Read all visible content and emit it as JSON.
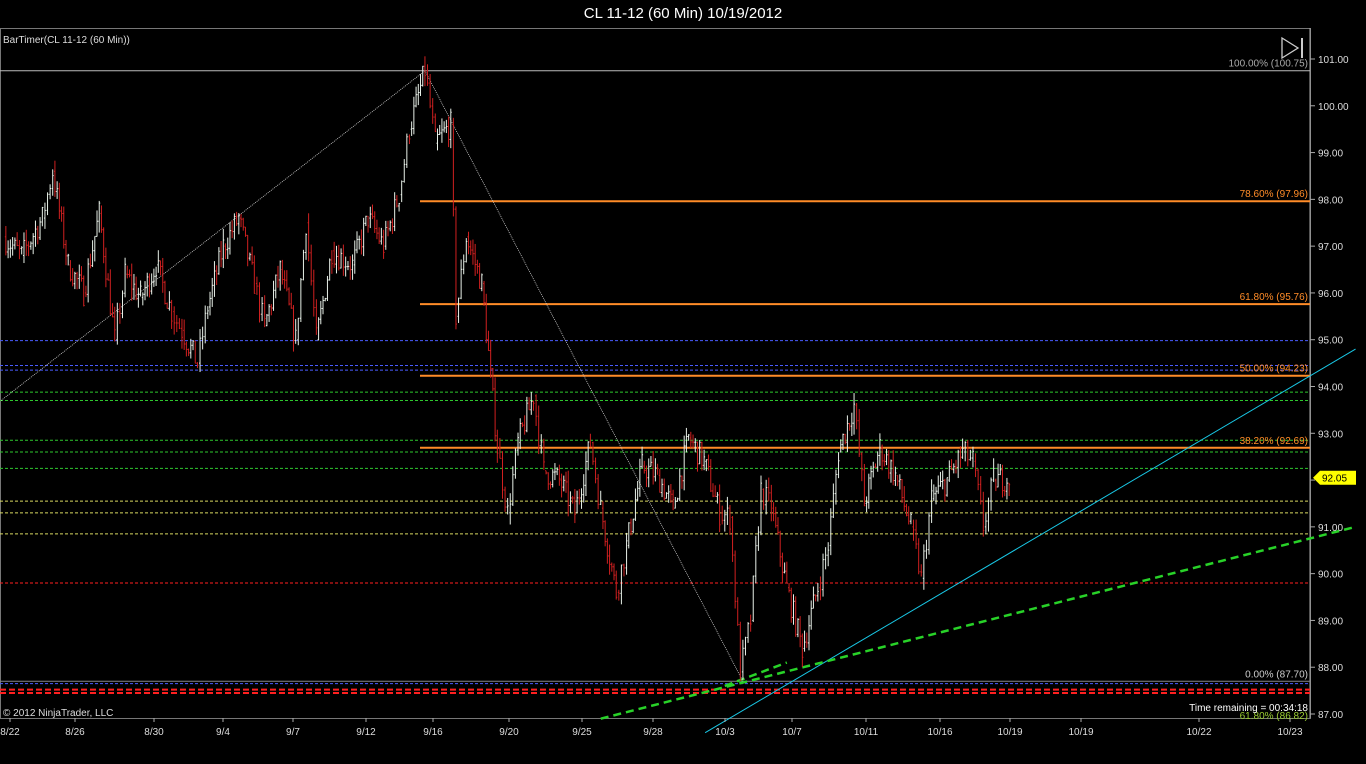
{
  "window": {
    "title": "CL 11-12 (60 Min)  10/19/2012"
  },
  "indicator_label": "BarTimer(CL 11-12 (60 Min))",
  "copyright": "© 2012 NinjaTrader, LLC",
  "time_remaining": "Time remaining = 00:34:18",
  "play_icon": "skip-forward-icon",
  "colors": {
    "background": "#000000",
    "grid": "#555555",
    "up_bar": "#e8f0e8",
    "down_bar": "#d02020",
    "fib": "#ff8c28",
    "price_tag": "#ffff00",
    "trend_cyan": "#19c8e6",
    "trend_green": "#28d228",
    "blue_level": "#4a5cff",
    "green_level": "#2ec82e",
    "yellow_level": "#d8d860",
    "red_level": "#ff2020"
  },
  "chart_data": {
    "type": "candlestick",
    "symbol": "CL 11-12",
    "interval": "60 Min",
    "ylim": [
      87.0,
      101.0
    ],
    "y_ticks": [
      "101.00",
      "100.00",
      "99.00",
      "98.00",
      "97.00",
      "96.00",
      "95.00",
      "94.00",
      "93.00",
      "92.00",
      "91.00",
      "90.00",
      "89.00",
      "88.00",
      "87.00"
    ],
    "x_ticks": [
      "8/22",
      "8/26",
      "8/30",
      "9/4",
      "9/7",
      "9/12",
      "9/16",
      "9/20",
      "9/25",
      "9/28",
      "10/3",
      "10/7",
      "10/11",
      "10/16",
      "10/19",
      "10/19",
      "10/22",
      "10/23"
    ],
    "last_price": "92.05",
    "fib_levels": [
      {
        "label": "100.00% (100.75)",
        "value": 100.75
      },
      {
        "label": "78.60% (97.96)",
        "value": 97.96
      },
      {
        "label": "61.80% (95.76)",
        "value": 95.76
      },
      {
        "label": "50.00% (94.23)",
        "value": 94.23
      },
      {
        "label": "38.20% (92.69)",
        "value": 92.69
      },
      {
        "label": "0.00% (87.70)",
        "value": 87.7
      },
      {
        "label": "61.80% (86.82)",
        "value": 86.82
      }
    ],
    "horizontal_levels": [
      {
        "kind": "blue",
        "value": 94.98
      },
      {
        "kind": "blue",
        "value": 94.45
      },
      {
        "kind": "blue",
        "value": 94.35
      },
      {
        "kind": "green",
        "value": 93.88
      },
      {
        "kind": "green",
        "value": 93.7
      },
      {
        "kind": "green",
        "value": 92.85
      },
      {
        "kind": "green",
        "value": 92.6
      },
      {
        "kind": "green",
        "value": 92.25
      },
      {
        "kind": "yellow",
        "value": 91.55
      },
      {
        "kind": "yellow",
        "value": 91.3
      },
      {
        "kind": "yellow",
        "value": 90.85
      },
      {
        "kind": "red",
        "value": 89.8
      },
      {
        "kind": "blue",
        "value": 87.65
      },
      {
        "kind": "red",
        "value": 87.52
      },
      {
        "kind": "red",
        "value": 87.45
      }
    ],
    "price_path": [
      [
        0.5,
        97.2
      ],
      [
        4,
        96.8
      ],
      [
        8,
        97.6
      ],
      [
        10,
        98.6
      ],
      [
        13,
        96.6
      ],
      [
        16,
        96.0
      ],
      [
        19,
        97.7
      ],
      [
        22,
        95.0
      ],
      [
        24,
        96.4
      ],
      [
        27,
        95.9
      ],
      [
        30,
        96.6
      ],
      [
        33,
        95.6
      ],
      [
        35,
        95.2
      ],
      [
        38,
        94.5
      ],
      [
        40,
        95.7
      ],
      [
        43,
        97.0
      ],
      [
        46,
        97.6
      ],
      [
        49,
        96.2
      ],
      [
        51,
        95.3
      ],
      [
        54,
        96.5
      ],
      [
        57,
        95.0
      ],
      [
        59,
        97.5
      ],
      [
        61,
        95.0
      ],
      [
        64,
        96.9
      ],
      [
        68,
        96.6
      ],
      [
        71,
        97.6
      ],
      [
        74,
        97.0
      ],
      [
        77,
        98.1
      ],
      [
        79,
        99.5
      ],
      [
        82,
        100.75
      ],
      [
        84,
        99.2
      ],
      [
        87,
        99.6
      ],
      [
        88,
        95.5
      ],
      [
        90,
        97.2
      ],
      [
        93,
        96.2
      ],
      [
        96,
        92.7
      ],
      [
        98,
        91.3
      ],
      [
        100,
        92.8
      ],
      [
        103,
        93.8
      ],
      [
        105,
        92.2
      ],
      [
        108,
        92.0
      ],
      [
        111,
        91.3
      ],
      [
        114,
        92.8
      ],
      [
        116,
        91.4
      ],
      [
        119,
        89.6
      ],
      [
        121,
        90.6
      ],
      [
        124,
        92.3
      ],
      [
        127,
        92.1
      ],
      [
        130,
        91.4
      ],
      [
        133,
        92.9
      ],
      [
        136,
        92.4
      ],
      [
        139,
        91.3
      ],
      [
        141,
        91.2
      ],
      [
        143,
        87.9
      ],
      [
        145,
        89.0
      ],
      [
        147,
        91.8
      ],
      [
        149,
        91.4
      ],
      [
        152,
        89.7
      ],
      [
        155,
        88.4
      ],
      [
        158,
        89.7
      ],
      [
        160,
        90.6
      ],
      [
        162,
        92.6
      ],
      [
        165,
        93.6
      ],
      [
        167,
        91.5
      ],
      [
        170,
        92.7
      ],
      [
        173,
        92.1
      ],
      [
        176,
        91.0
      ],
      [
        178,
        89.9
      ],
      [
        180,
        91.6
      ],
      [
        183,
        92.0
      ],
      [
        186,
        92.6
      ],
      [
        188,
        92.4
      ],
      [
        190,
        91.0
      ],
      [
        192,
        92.0
      ],
      [
        195,
        92.05
      ]
    ],
    "trendlines": [
      {
        "kind": "cyan",
        "from": [
          136.2,
          86.6
        ],
        "to": [
          262,
          94.8
        ]
      },
      {
        "kind": "green-dashed",
        "from": [
          116,
          86.9
        ],
        "to": [
          262,
          91.0
        ]
      },
      {
        "kind": "green-dashed",
        "from": [
          140,
          87.6
        ],
        "to": [
          152,
          88.1
        ]
      },
      {
        "kind": "white-thin",
        "from": [
          0,
          93.7
        ],
        "to": [
          82,
          100.75
        ]
      },
      {
        "kind": "white-thin",
        "from": [
          82,
          100.75
        ],
        "to": [
          143.5,
          87.7
        ]
      }
    ]
  }
}
